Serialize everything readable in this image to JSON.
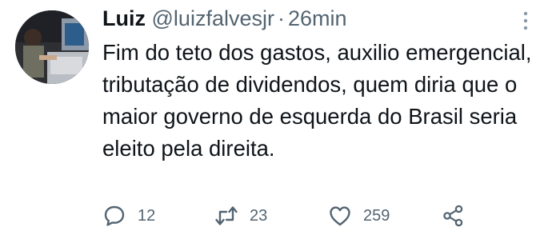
{
  "tweet": {
    "author": {
      "display_name": "Luiz",
      "handle": "@luizfalvesjr"
    },
    "separator": "·",
    "timestamp": "26min",
    "text": "Fim do teto dos gastos, auxilio emergencial, tributação de dividendos, quem diria que o maior governo de esquerda do Brasil seria eleito pela direita.",
    "actions": {
      "replies": "12",
      "retweets": "23",
      "likes": "259"
    },
    "icons": {
      "reply": "speech-bubble-icon",
      "retweet": "retweet-arrows-icon",
      "like": "heart-outline-icon",
      "share": "share-nodes-icon",
      "more": "vertical-ellipsis-icon"
    },
    "colors": {
      "text": "#0f1419",
      "secondary": "#536471"
    }
  }
}
